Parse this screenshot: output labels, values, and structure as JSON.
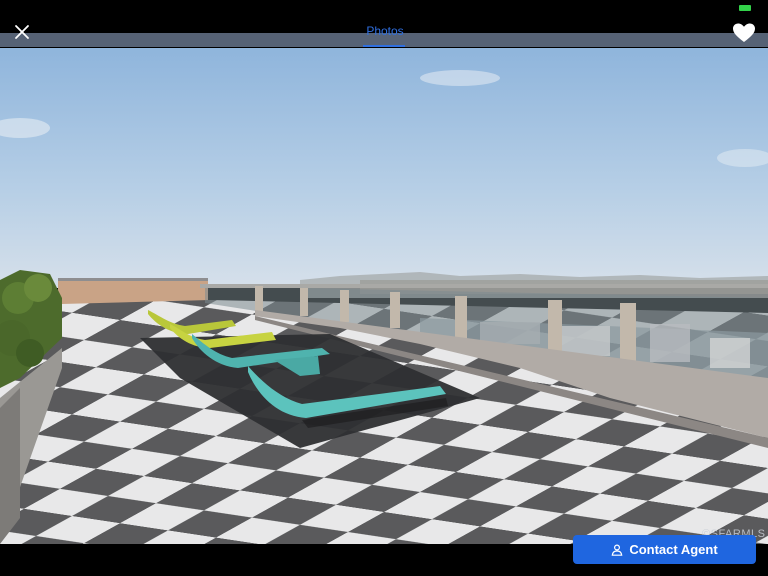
{
  "header": {
    "tab_label": "Photos",
    "close_icon": "close-icon",
    "favorite_icon": "heart-icon"
  },
  "photo": {
    "watermark": "©SFARMLS"
  },
  "footer": {
    "contact_label": "Contact Agent",
    "contact_icon": "user-icon"
  },
  "colors": {
    "accent": "#1f66e0",
    "tab_active": "#2f6fe0",
    "battery": "#33d24a"
  }
}
